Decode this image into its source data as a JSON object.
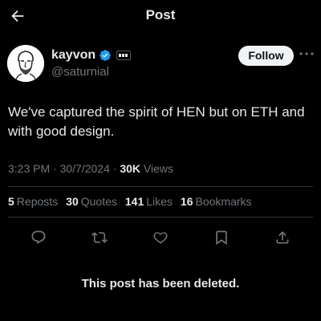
{
  "header": {
    "title": "Post"
  },
  "author": {
    "display_name": "kayvon",
    "handle": "@saturnial"
  },
  "follow_label": "Follow",
  "post": {
    "text": "We've captured the spirit of HEN but on ETH and with good design."
  },
  "meta": {
    "time": "3:23 PM",
    "sep1": "·",
    "date": "30/7/2024",
    "sep2": "·",
    "views_count": "30K",
    "views_label": "Views"
  },
  "stats": {
    "reposts": {
      "count": "5",
      "label": "Reposts"
    },
    "quotes": {
      "count": "30",
      "label": "Quotes"
    },
    "likes": {
      "count": "141",
      "label": "Likes"
    },
    "bookmarks": {
      "count": "16",
      "label": "Bookmarks"
    }
  },
  "actions": [
    "reply-icon",
    "repost-icon",
    "like-icon",
    "bookmark-icon",
    "share-icon"
  ],
  "deleted_notice": "This post has been deleted.",
  "colors": {
    "background": "#000000",
    "text": "#e7e9ea",
    "muted": "#71767b",
    "verified": "#1d9bf0",
    "divider": "#2f3336"
  }
}
